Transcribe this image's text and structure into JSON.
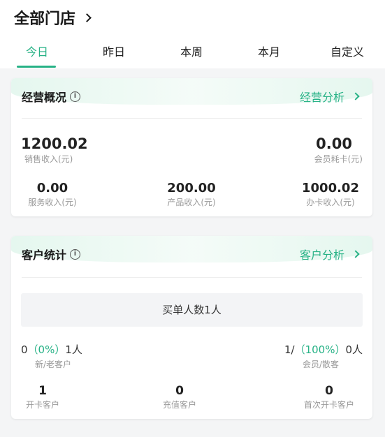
{
  "header": {
    "store_title": "全部门店"
  },
  "tabs": [
    {
      "label": "今日",
      "active": true
    },
    {
      "label": "昨日",
      "active": false
    },
    {
      "label": "本周",
      "active": false
    },
    {
      "label": "本月",
      "active": false
    },
    {
      "label": "自定义",
      "active": false
    }
  ],
  "business": {
    "title": "经营概况",
    "link": "经营分析",
    "sales_income": {
      "value": "1200.02",
      "label": "销售收入(元)"
    },
    "member_card_use": {
      "value": "0.00",
      "label": "会员耗卡(元)"
    },
    "service_income": {
      "value": "0.00",
      "label": "服务收入(元)"
    },
    "product_income": {
      "value": "200.00",
      "label": "产品收入(元)"
    },
    "card_income": {
      "value": "1000.02",
      "label": "办卡收入(元)"
    }
  },
  "customers": {
    "title": "客户统计",
    "link": "客户分析",
    "buyers": "买单人数1人",
    "new_old": {
      "prefix": "0",
      "pct": "（0%）",
      "suffix": "1人",
      "label": "新/老客户"
    },
    "member_walkin": {
      "prefix": "1/",
      "pct": "（100%）",
      "suffix": "0人",
      "label": "会员/散客"
    },
    "card_open": {
      "value": "1",
      "label": "开卡客户"
    },
    "recharge": {
      "value": "0",
      "label": "充值客户"
    },
    "first_card": {
      "value": "0",
      "label": "首次开卡客户"
    }
  },
  "colors": {
    "accent": "#27b286",
    "muted_text": "#999999",
    "background": "#f4f5f6"
  },
  "icons": {
    "title_chevron": "chevron-right-icon",
    "info": "info-icon",
    "link_chevron": "chevron-right-icon"
  }
}
